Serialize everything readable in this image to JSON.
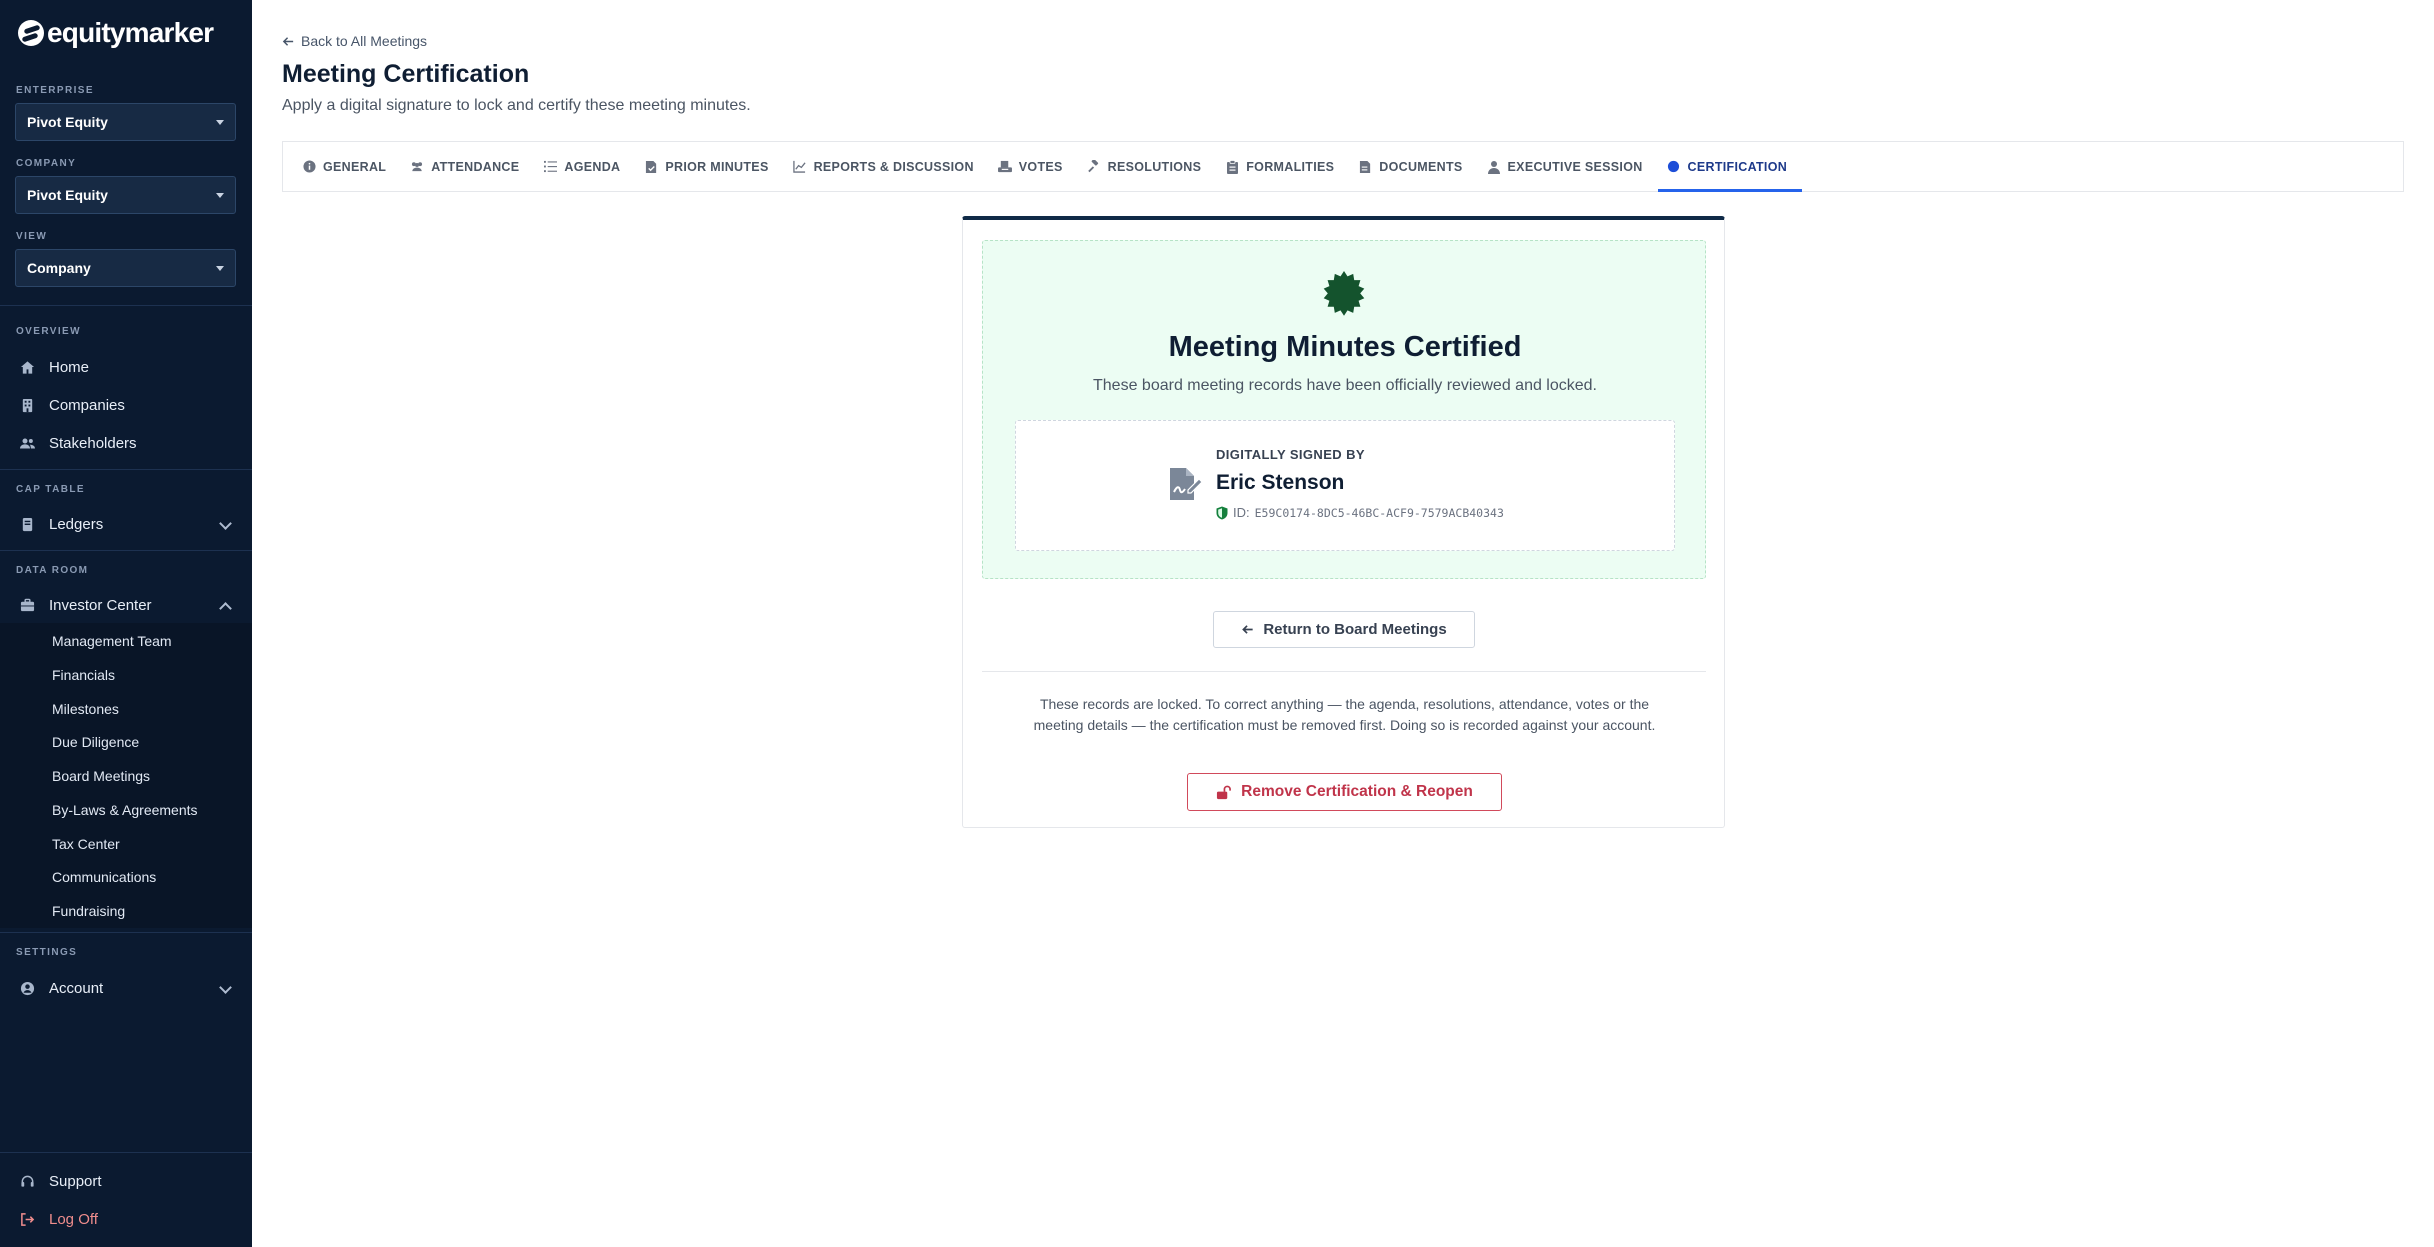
{
  "brand": {
    "name": "equitymarker"
  },
  "sidebar": {
    "enterprise": {
      "label": "ENTERPRISE",
      "value": "Pivot Equity"
    },
    "company": {
      "label": "COMPANY",
      "value": "Pivot Equity"
    },
    "view": {
      "label": "VIEW",
      "value": "Company"
    },
    "sections": {
      "overview": "OVERVIEW",
      "cap_table": "CAP TABLE",
      "data_room": "DATA ROOM",
      "settings": "SETTINGS"
    },
    "nav": {
      "home": "Home",
      "companies": "Companies",
      "stakeholders": "Stakeholders",
      "ledgers": "Ledgers",
      "investor_center": "Investor Center",
      "account": "Account",
      "support": "Support",
      "log_off": "Log Off"
    },
    "investor_center_items": [
      "Management Team",
      "Financials",
      "Milestones",
      "Due Diligence",
      "Board Meetings",
      "By-Laws & Agreements",
      "Tax Center",
      "Communications",
      "Fundraising"
    ]
  },
  "header": {
    "back_link": "Back to All Meetings",
    "title": "Meeting Certification",
    "subtitle": "Apply a digital signature to lock and certify these meeting minutes."
  },
  "tabs": [
    {
      "label": "GENERAL",
      "icon": "info-icon"
    },
    {
      "label": "ATTENDANCE",
      "icon": "users-icon"
    },
    {
      "label": "AGENDA",
      "icon": "list-icon"
    },
    {
      "label": "PRIOR MINUTES",
      "icon": "file-check-icon"
    },
    {
      "label": "REPORTS & DISCUSSION",
      "icon": "chart-icon"
    },
    {
      "label": "VOTES",
      "icon": "ballot-icon"
    },
    {
      "label": "RESOLUTIONS",
      "icon": "gavel-icon"
    },
    {
      "label": "FORMALITIES",
      "icon": "clipboard-icon"
    },
    {
      "label": "DOCUMENTS",
      "icon": "document-icon"
    },
    {
      "label": "EXECUTIVE SESSION",
      "icon": "user-lock-icon"
    },
    {
      "label": "CERTIFICATION",
      "icon": "dot-icon",
      "active": true
    }
  ],
  "certification": {
    "title": "Meeting Minutes Certified",
    "subtitle": "These board meeting records have been officially reviewed and locked.",
    "signed_by_label": "DIGITALLY SIGNED BY",
    "signer_name": "Eric Stenson",
    "id_prefix": "ID:",
    "signature_id": "E59C0174-8DC5-46BC-ACF9-7579ACB40343",
    "return_button": "Return to Board Meetings",
    "lock_note": "These records are locked. To correct anything — the agenda, resolutions, attendance, votes or the meeting details — the certification must be removed first. Doing so is recorded against your account.",
    "remove_button": "Remove Certification & Reopen"
  },
  "colors": {
    "sidebar_bg": "#0b1a30",
    "accent_blue": "#2563eb",
    "seal_green": "#14532d",
    "cert_bg": "#ecfdf3",
    "danger": "#c0344a"
  }
}
